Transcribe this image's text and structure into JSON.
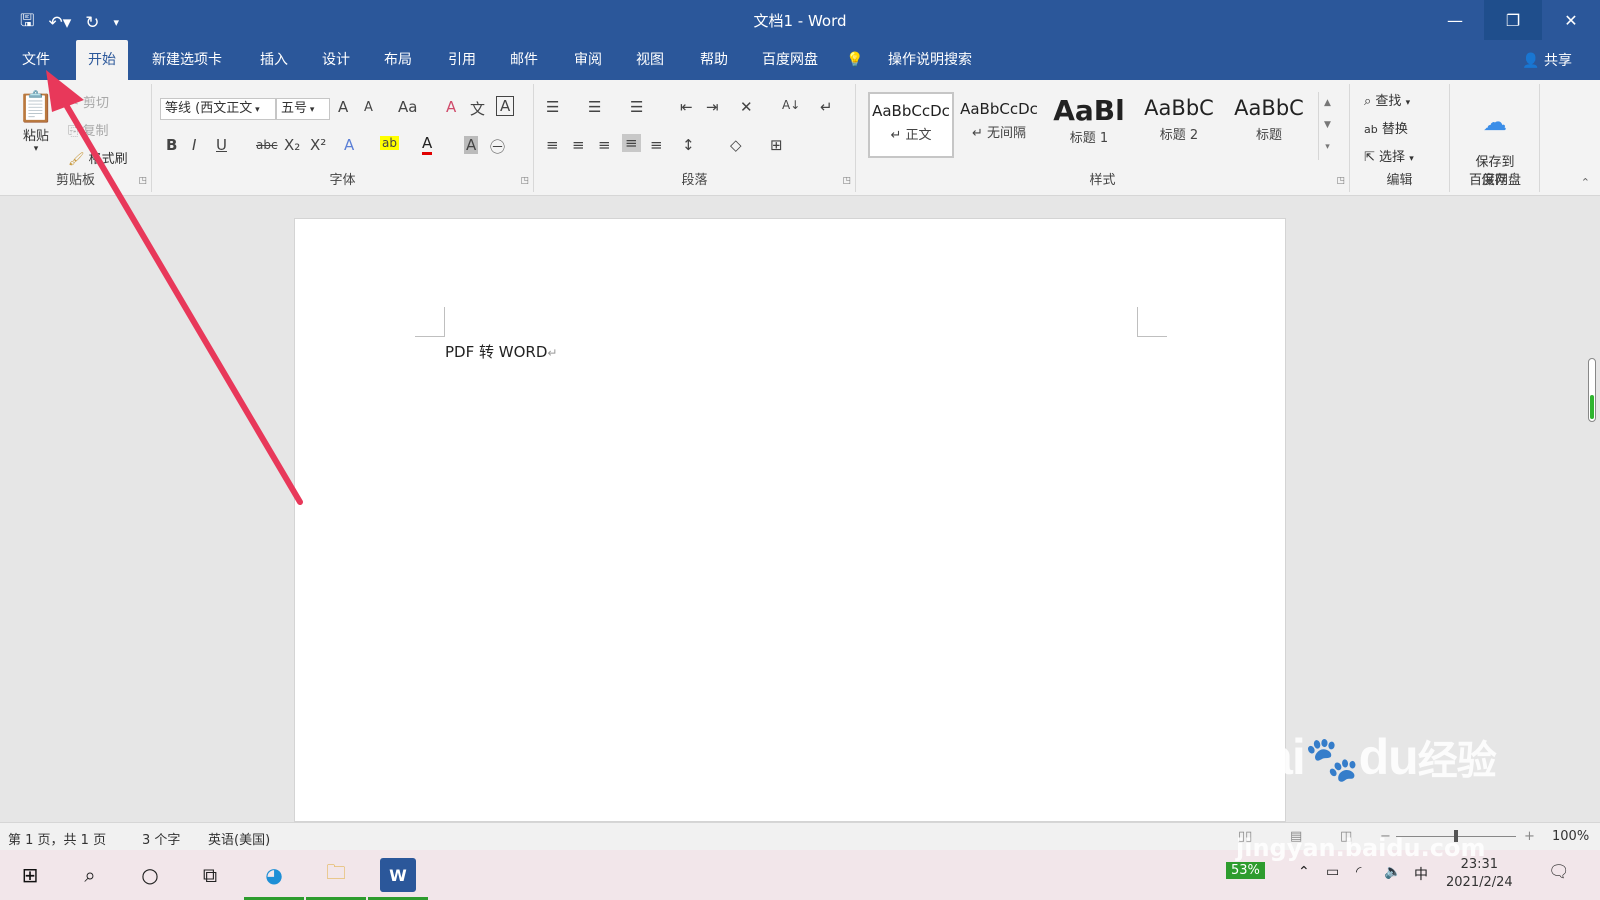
{
  "title_bar": {
    "title": "文档1  -  Word",
    "qat": {
      "save_icon": "save-icon",
      "undo_icon": "undo-icon",
      "redo_icon": "redo-icon",
      "customize_icon": "customize-qat-icon"
    },
    "controls": {
      "minimize": "—",
      "restore": "❐",
      "close": "✕"
    }
  },
  "tabs": [
    {
      "label": "文件"
    },
    {
      "label": "开始",
      "active": true
    },
    {
      "label": "新建选项卡"
    },
    {
      "label": "插入"
    },
    {
      "label": "设计"
    },
    {
      "label": "布局"
    },
    {
      "label": "引用"
    },
    {
      "label": "邮件"
    },
    {
      "label": "审阅"
    },
    {
      "label": "视图"
    },
    {
      "label": "帮助"
    },
    {
      "label": "百度网盘"
    },
    {
      "label": "操作说明搜索"
    }
  ],
  "share_label": "共享",
  "ribbon": {
    "clipboard": {
      "paste": "粘贴",
      "cut": "剪切",
      "copy": "复制",
      "format_painter": "格式刷",
      "label": "剪贴板"
    },
    "font": {
      "font_name": "等线 (西文正文",
      "font_size": "五号",
      "grow": "A",
      "shrink": "A",
      "change_case": "Aa",
      "clear_format": "A",
      "phonetic": "文",
      "char_border": "A",
      "bold": "B",
      "italic": "I",
      "underline": "U",
      "strike": "abc",
      "subscript": "X₂",
      "superscript": "X²",
      "text_effect": "A",
      "highlight": "ab",
      "font_color": "A",
      "char_shading": "A",
      "enclose": "㊀",
      "label": "字体"
    },
    "paragraph": {
      "label": "段落",
      "bullets": "☰",
      "numbering": "☰",
      "multilevel": "☰",
      "dec_indent": "⇤",
      "inc_indent": "⇥",
      "chinese_layout": "✕",
      "sort": "A↓",
      "show_marks": "↵",
      "align_left": "≡",
      "center": "≡",
      "align_right": "≡",
      "justify": "≡",
      "distributed": "≡",
      "line_spacing": "↕",
      "shading": "◇",
      "borders": "⊞"
    },
    "styles": {
      "label": "样式",
      "items": [
        {
          "sample": "AaBbCcDc",
          "name": "↵ 正文"
        },
        {
          "sample": "AaBbCcDc",
          "name": "↵ 无间隔"
        },
        {
          "sample": "AaBl",
          "name": "标题 1"
        },
        {
          "sample": "AaBbC",
          "name": "标题 2"
        },
        {
          "sample": "AaBbC",
          "name": "标题"
        }
      ]
    },
    "editing": {
      "label": "编辑",
      "find": "查找",
      "replace": "替换",
      "select": "选择"
    },
    "save": {
      "label": "保存",
      "button": "保存到\n百度网盘"
    }
  },
  "document": {
    "text": "PDF 转 WORD",
    "para_mark": "↵"
  },
  "status": {
    "page": "第 1 页，共 1 页",
    "words": "3 个字",
    "language": "英语(美国)",
    "zoom": "100%"
  },
  "taskbar": {
    "battery": "53%",
    "ime": "中",
    "time": "23:31",
    "date": "2021/2/24"
  },
  "watermark": {
    "brand": "Bai",
    "brand2": "du",
    "brand_cn": "经验",
    "url": "jingyan.baidu.com"
  },
  "colors": {
    "accent": "#2b579a",
    "arrow": "#e8385a"
  }
}
